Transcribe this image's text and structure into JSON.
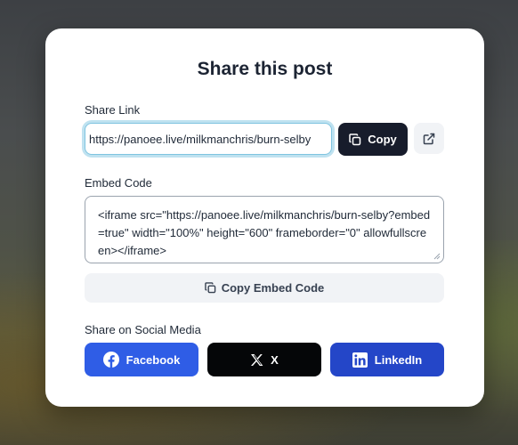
{
  "modal": {
    "title": "Share this post"
  },
  "share_link": {
    "label": "Share Link",
    "value": "https://panoee.live/milkmanchris/burn-selby",
    "copy_label": "Copy"
  },
  "embed": {
    "label": "Embed Code",
    "code": "<iframe src=\"https://panoee.live/milkmanchris/burn-selby?embed=true\" width=\"100%\" height=\"600\" frameborder=\"0\" allowfullscreen></iframe>",
    "copy_label": "Copy Embed Code"
  },
  "social": {
    "label": "Share on Social Media",
    "buttons": [
      {
        "label": "Facebook",
        "icon": "facebook-icon",
        "color": "#2f5de6"
      },
      {
        "label": "X",
        "icon": "x-icon",
        "color": "#050608"
      },
      {
        "label": "LinkedIn",
        "icon": "linkedin-icon",
        "color": "#2446c8"
      }
    ]
  },
  "colors": {
    "primary_dark": "#171c2b",
    "focus_ring": "#bfe2f0",
    "secondary_bg": "#f1f3f6"
  }
}
